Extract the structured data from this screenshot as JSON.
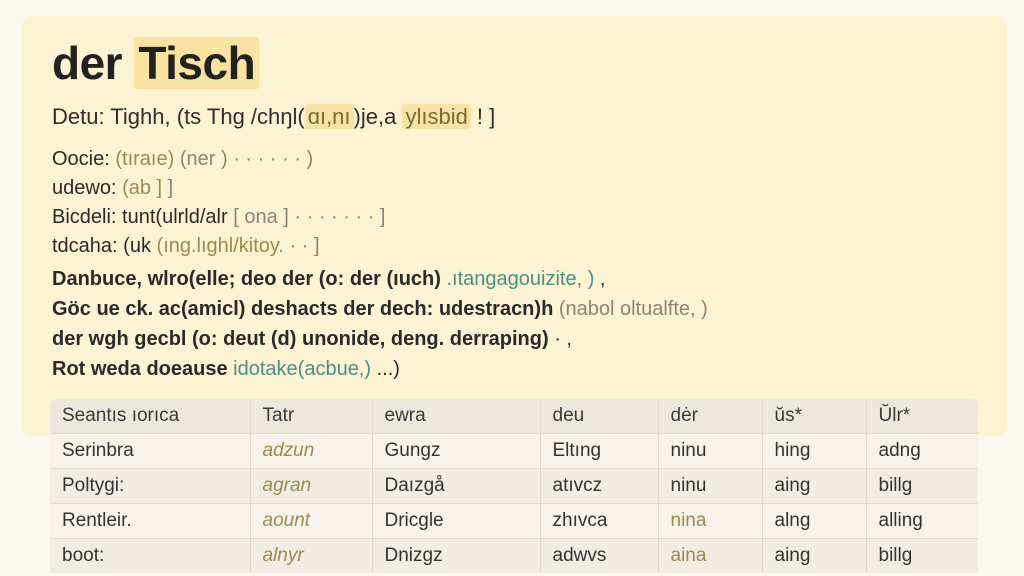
{
  "header": {
    "title_prefix": "der",
    "title_word": "Tisch"
  },
  "pronunciation": {
    "part1": "Detu: Tighh, (ts Thg /chŋl(",
    "part2": "ɑı,nı",
    "part3": ")je,a ",
    "part4": "ylısbid",
    "part5": " ! ]"
  },
  "forms": [
    {
      "label": "Oocie:",
      "a": "(tıraıe)",
      "b": "(ner )",
      "c": "· · · · · · )"
    },
    {
      "label": "udewo:",
      "a": "(ab ]",
      "b": "",
      "c": "]"
    },
    {
      "label": "Bicdeli:",
      "a": "tunt(ulrld/alr",
      "b": "[ ona ]",
      "c": "· · ·  · · · · ]"
    },
    {
      "label": "tdcaha:",
      "a": "(uk",
      "b": "(ıng.lıghl/kitoy.",
      "c": "· · ]"
    }
  ],
  "examples": [
    {
      "main": "Danbuce, wlro(elle; deo der (o: der (ıuch)",
      "extra": " .ıtangagouizite, )",
      "end": " ,"
    },
    {
      "main": "Göc ue ck. ac(amicl) deshacts der dech: udestracn)h",
      "extra": " (nabol oltualfte, )",
      "end": ""
    },
    {
      "main": "der wgh gecbl (o: deut (d) unonide, deng. derraping)",
      "extra": "",
      "end": " · ,"
    },
    {
      "main": "Rot weda doeause",
      "extra": " idotake(acbue,)",
      "end": " ...)"
    }
  ],
  "table": {
    "headers": [
      "Seantıs ıorıca",
      "Tatr",
      "ewra",
      "deu",
      "dėr",
      "ŭs*",
      "ŬƖr*"
    ],
    "rows": [
      [
        "Serinbra",
        "adzun",
        "Gungz",
        "Eltıng",
        "ninu",
        "hing",
        "adng"
      ],
      [
        "Poltygi:",
        "agran",
        "Daızgå",
        "atıvcz",
        "ninu",
        "aing",
        "billg"
      ],
      [
        "Rentleir.",
        "aount",
        "Dricgle",
        "zhıvca",
        "nina",
        "alng",
        "alling"
      ],
      [
        "boot:",
        "alnyr",
        "Dnizgz",
        "adwvs",
        "aina",
        "aing",
        "billg"
      ]
    ]
  }
}
